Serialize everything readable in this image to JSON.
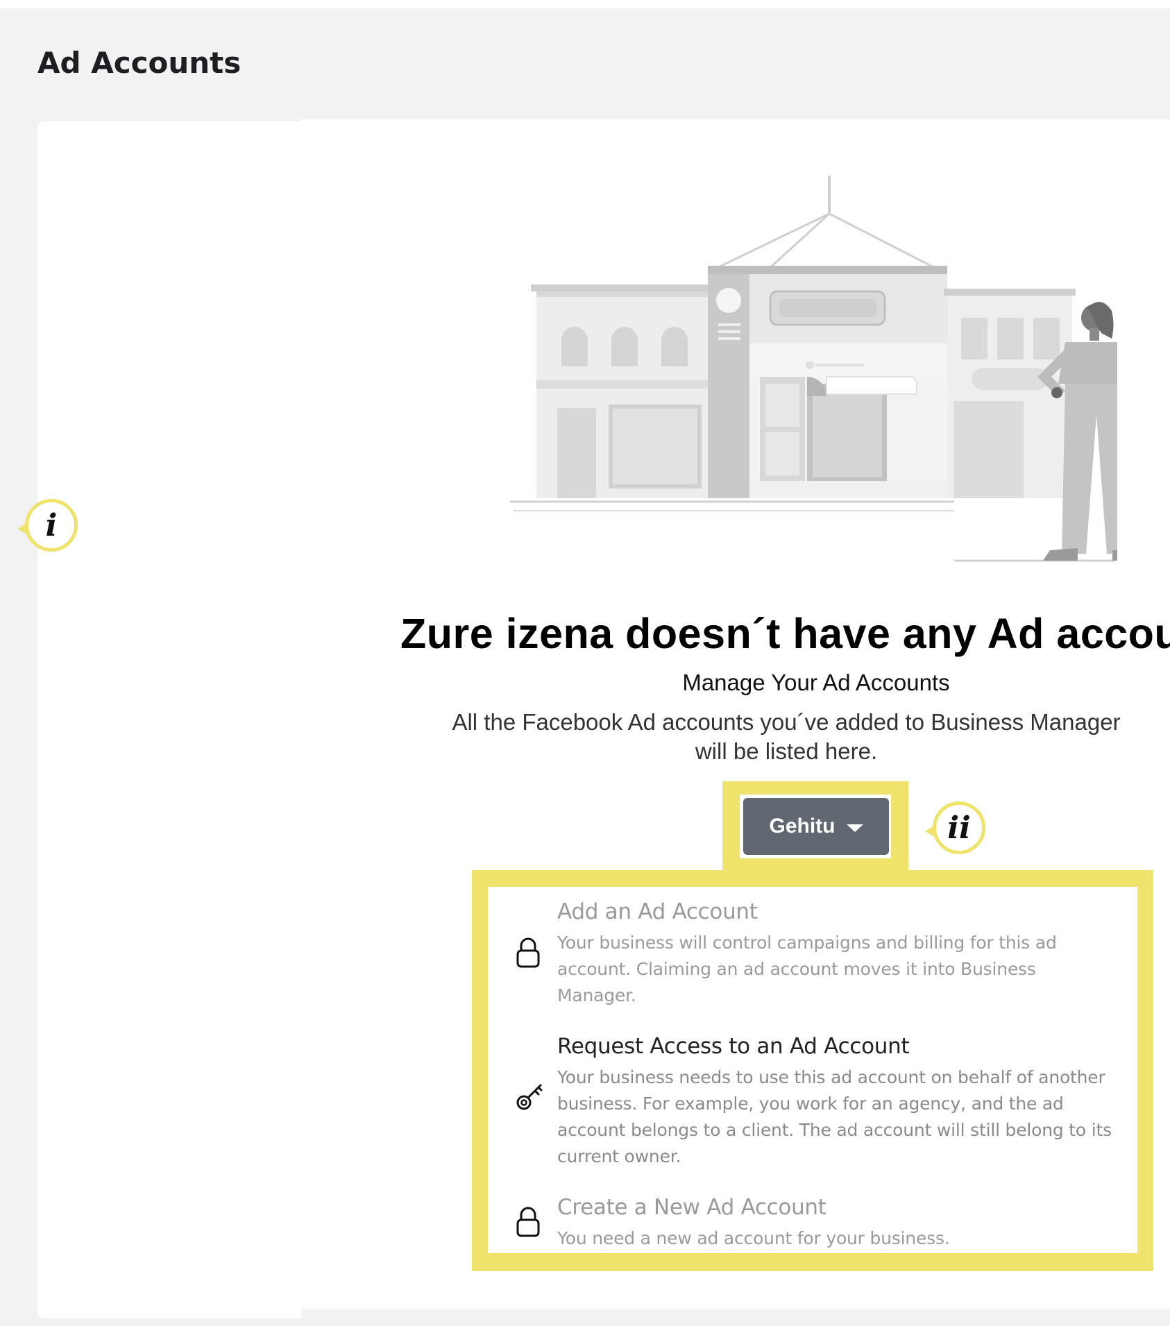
{
  "page": {
    "title": "Ad Accounts"
  },
  "callouts": {
    "left": "i",
    "button": "ii"
  },
  "empty_state": {
    "headline": "Zure izena doesn´t have any Ad accou",
    "subhead": "Manage Your Ad Accounts",
    "description_line1": "All the Facebook Ad accounts you´ve added to Business Manager",
    "description_line2": "will be listed here."
  },
  "add_button": {
    "label": "Gehitu"
  },
  "menu": {
    "items": [
      {
        "title": "Add an Ad Account",
        "body": "Your business will control campaigns and billing for this ad account. Claiming an ad account moves it into Business Manager.",
        "icon": "lock-icon",
        "enabled": false
      },
      {
        "title": "Request Access to an Ad Account",
        "body": "Your business needs to use this ad account on behalf of another business. For example, you work for an agency, and the ad account belongs to a client. The ad account will still belong to its current owner.",
        "icon": "key-icon",
        "enabled": true
      },
      {
        "title": "Create a New Ad Account",
        "body": "You need a new ad account for your business.",
        "icon": "lock-icon",
        "enabled": false
      }
    ]
  },
  "colors": {
    "highlight": "#f0e36b",
    "button": "#606770",
    "background": "#f2f2f2"
  }
}
